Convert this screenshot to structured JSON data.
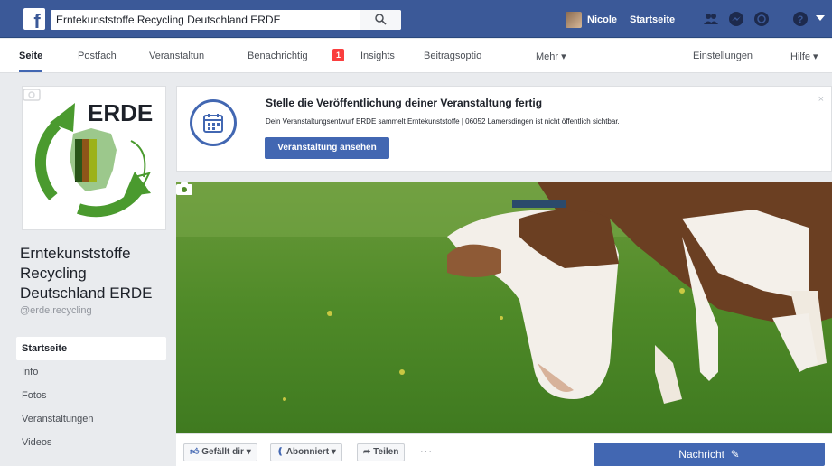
{
  "topbar": {
    "search_value": "Erntekunststoffe Recycling Deutschland ERDE",
    "profile_name": "Nicole",
    "home_label": "Startseite"
  },
  "pagenav": {
    "items": [
      {
        "label": "Seite",
        "active": true
      },
      {
        "label": "Postfach"
      },
      {
        "label": "Veranstaltun"
      },
      {
        "label": "Benachrichtig"
      },
      {
        "label": "Insights"
      },
      {
        "label": "Beitragsoptio"
      },
      {
        "label": "Mehr ▾"
      },
      {
        "label": "Einstellungen"
      },
      {
        "label": "Hilfe ▾"
      }
    ],
    "badge": "1"
  },
  "page": {
    "logo_text": "ERDE",
    "name": "Erntekunststoffe Recycling Deutschland ERDE",
    "handle": "@erde.recycling"
  },
  "leftnav": {
    "items": [
      {
        "label": "Startseite",
        "active": true
      },
      {
        "label": "Info"
      },
      {
        "label": "Fotos"
      },
      {
        "label": "Veranstaltungen"
      },
      {
        "label": "Videos"
      }
    ]
  },
  "event_card": {
    "title": "Stelle die Veröffentlichung deiner Veranstaltung fertig",
    "description": "Dein Veranstaltungsentwurf ERDE sammelt Erntekunststoffe | 06052 Lamersdingen ist nicht öffentlich sichtbar.",
    "button_label": "Veranstaltung ansehen",
    "close_label": "×"
  },
  "actions": {
    "like_label": "Gefällt dir ▾",
    "follow_label": "Abonniert ▾",
    "share_label": "Teilen",
    "more_label": "···",
    "message_label": "Nachricht"
  },
  "colors": {
    "brand_blue": "#3b5998",
    "button_blue": "#4267b2",
    "badge_red": "#fa3e3e",
    "logo_green": "#4a9a2e"
  }
}
